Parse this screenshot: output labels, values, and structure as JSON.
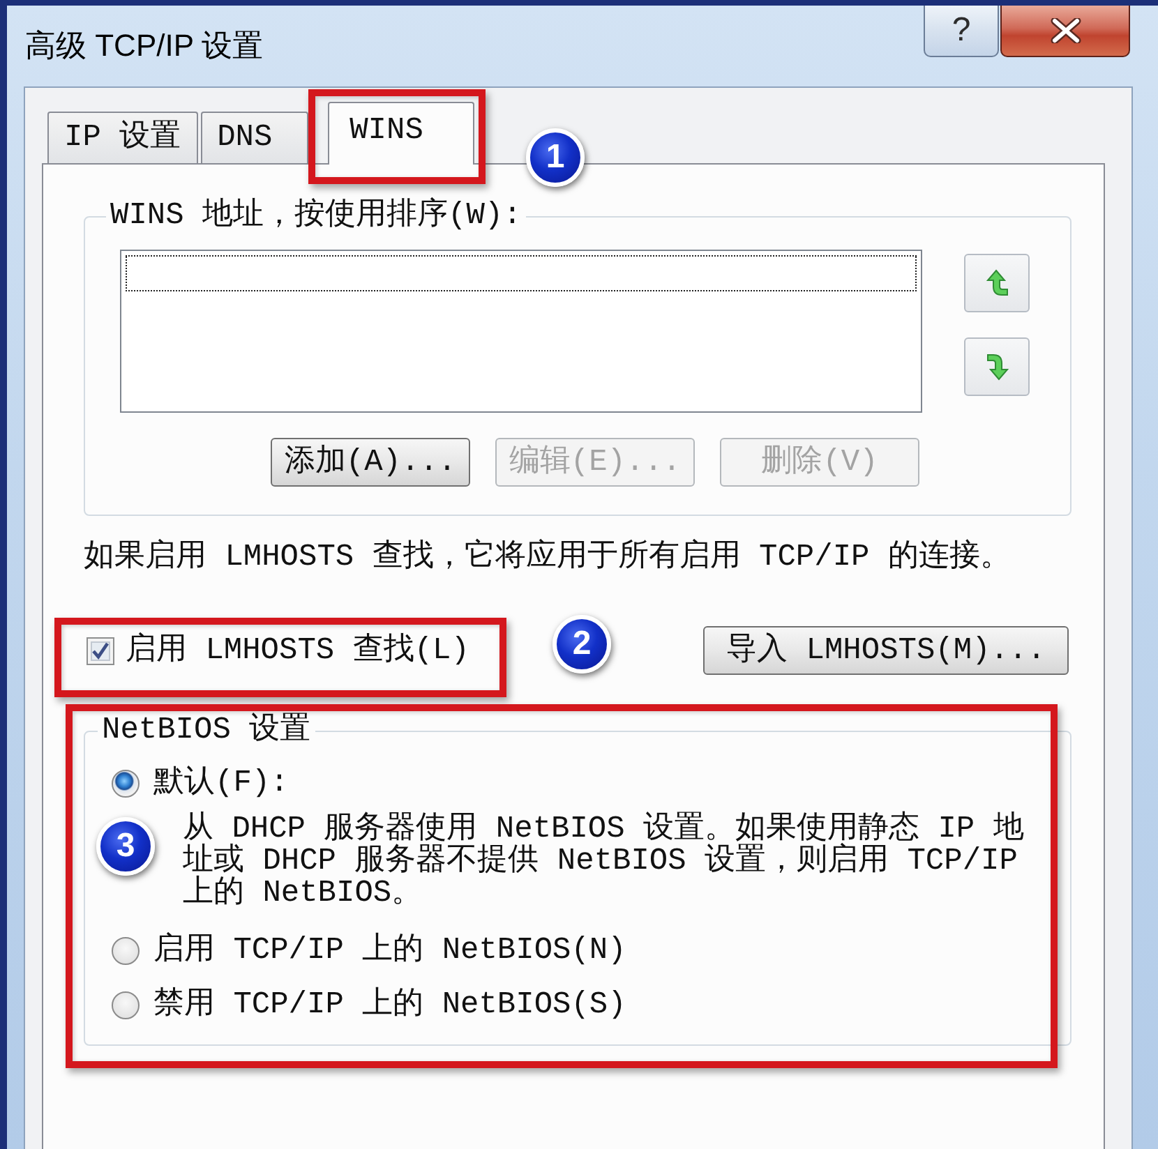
{
  "window": {
    "title": "高级 TCP/IP 设置",
    "help_label": "?"
  },
  "tabs": [
    {
      "label": "IP 设置",
      "selected": false
    },
    {
      "label": "DNS",
      "selected": false
    },
    {
      "label": "WINS",
      "selected": true
    }
  ],
  "wins": {
    "label": "WINS 地址，按使用排序(W):",
    "address_list": {
      "focused": true
    },
    "buttons": [
      {
        "label": "添加(A)...",
        "disabled": false
      },
      {
        "label": "编辑(E)...",
        "disabled": true
      },
      {
        "label": "删除(V)",
        "disabled": true
      }
    ]
  },
  "lmhosts": {
    "note": "如果启用 LMHOSTS 查找，它将应用于所有启用 TCP/IP 的连接。",
    "checkbox": {
      "label": "启用 LMHOSTS 查找(L)",
      "checked": true
    },
    "import_button": "导入 LMHOSTS(M)..."
  },
  "netbios": {
    "label": "NetBIOS 设置",
    "options": [
      {
        "label": "默认(F):",
        "selected": true,
        "description": "从 DHCP 服务器使用 NetBIOS 设置。如果使用静态 IP 地址或 DHCP 服务器不提供 NetBIOS 设置，则启用 TCP/IP 上的 NetBIOS。"
      },
      {
        "label": "启用 TCP/IP 上的 NetBIOS(N)",
        "selected": false
      },
      {
        "label": "禁用 TCP/IP 上的 NetBIOS(S)",
        "selected": false
      }
    ]
  },
  "annotations": [
    {
      "label": "1"
    },
    {
      "label": "2"
    },
    {
      "label": "3"
    }
  ]
}
